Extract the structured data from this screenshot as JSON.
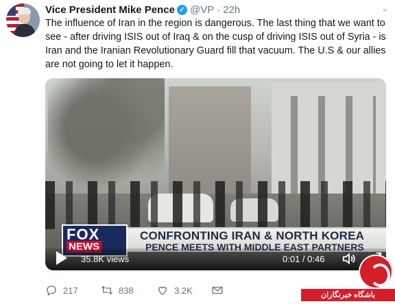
{
  "author": {
    "name": "Vice President Mike Pence",
    "handle": "@VP",
    "separator": "·",
    "time": "22h",
    "verified": true
  },
  "tweet": {
    "text": "The influence of Iran in the region is dangerous. The last thing that we want to see - after driving ISIS out of Iraq & on the cusp of driving ISIS out of Syria - is Iran and the Iranian Revolutionary Guard fill that vacuum. The U.S & our allies are not going to let it happen."
  },
  "video": {
    "views": "35.8K views",
    "timecode": "0:01 / 0:46",
    "channel_top": "FOX",
    "channel_bottom": "NEWS",
    "chyron_line1": "CONFRONTING IRAN & NORTH KOREA",
    "chyron_line2": "PENCE MEETS WITH MIDDLE EAST PARTNERS"
  },
  "actions": {
    "replies": "217",
    "retweets": "838",
    "likes": "3.2K"
  },
  "watermark": {
    "text": "باشگاه خبرنگاران"
  },
  "colors": {
    "accent": "#1da1f2",
    "text": "#14171a",
    "muted": "#657786",
    "fox_blue": "#1a2a5c",
    "fox_red": "#c8102e",
    "watermark_red": "#d41f2a"
  },
  "icons": {
    "verified": "verified-badge-icon",
    "reply": "reply-icon",
    "retweet": "retweet-icon",
    "like": "heart-icon",
    "message": "envelope-icon",
    "play": "play-icon",
    "volume": "volume-icon",
    "fullscreen": "fullscreen-icon",
    "more": "chevron-down-icon"
  }
}
